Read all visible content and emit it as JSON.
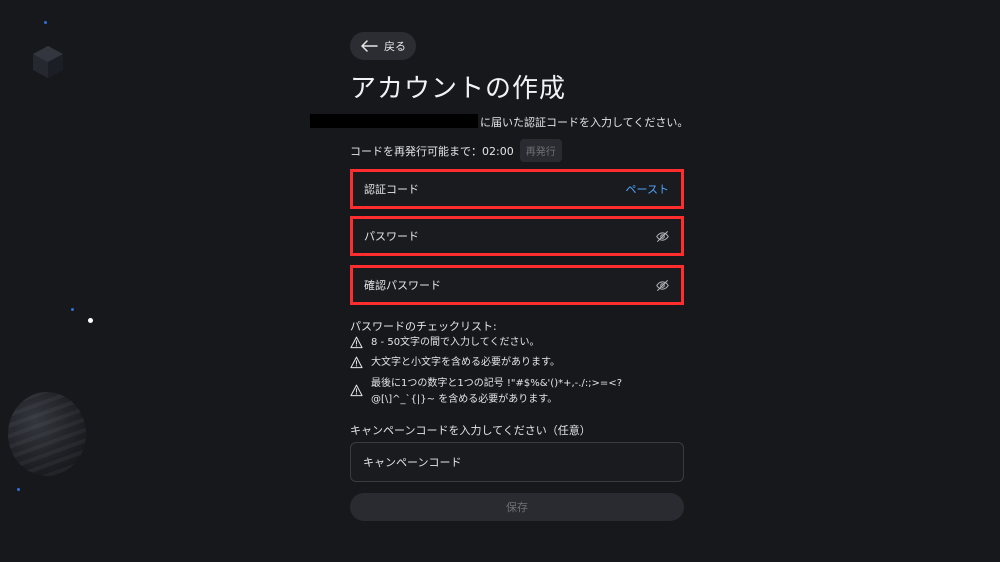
{
  "header": {
    "back_label": "戻る",
    "title": "アカウントの作成"
  },
  "verification": {
    "sent_message": "に届いた認証コードを入力してください。",
    "resend_countdown": "コードを再発行可能まで：02:00",
    "resend_button": "再発行"
  },
  "form": {
    "code_label": "認証コード",
    "paste_label": "ペースト",
    "password_label": "パスワード",
    "confirm_password_label": "確認パスワード"
  },
  "checklist": {
    "title": "パスワードのチェックリスト:",
    "items": [
      "8 - 50文字の間で入力してください。",
      "大文字と小文字を含める必要があります。",
      "最後に1つの数字と1つの記号 !\"#$%&'()*+,-./:;>=<?@[\\]^_`{|}~ を含める必要があります。"
    ]
  },
  "campaign": {
    "label": "キャンペーンコードを入力してください（任意）",
    "placeholder": "キャンペーンコード"
  },
  "footer": {
    "save_label": "保存"
  },
  "colors": {
    "background": "#17181c",
    "highlight_border": "#ff2d2d",
    "link": "#4ea3ff",
    "disabled_text": "#6e6f76"
  }
}
